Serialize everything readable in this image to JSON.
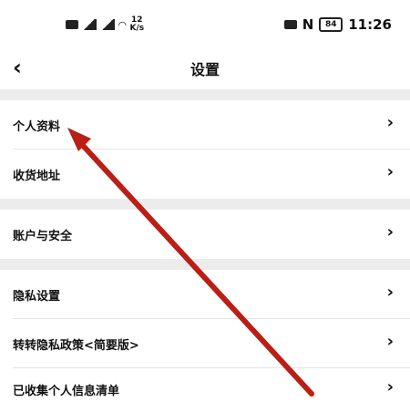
{
  "status_bar": {
    "net_speed": "12",
    "net_unit": "K/s",
    "battery": "84",
    "time": "11:26"
  },
  "nav": {
    "title": "设置",
    "back_icon": "chevron-left-icon"
  },
  "rows": [
    {
      "label": "个人资料"
    },
    {
      "label": "收货地址"
    },
    {
      "label": "账户与安全"
    },
    {
      "label": "隐私设置"
    },
    {
      "label": "转转隐私政策<简要版>"
    },
    {
      "label": "已收集个人信息清单"
    }
  ],
  "arrow": {
    "color": "#b91f16"
  }
}
